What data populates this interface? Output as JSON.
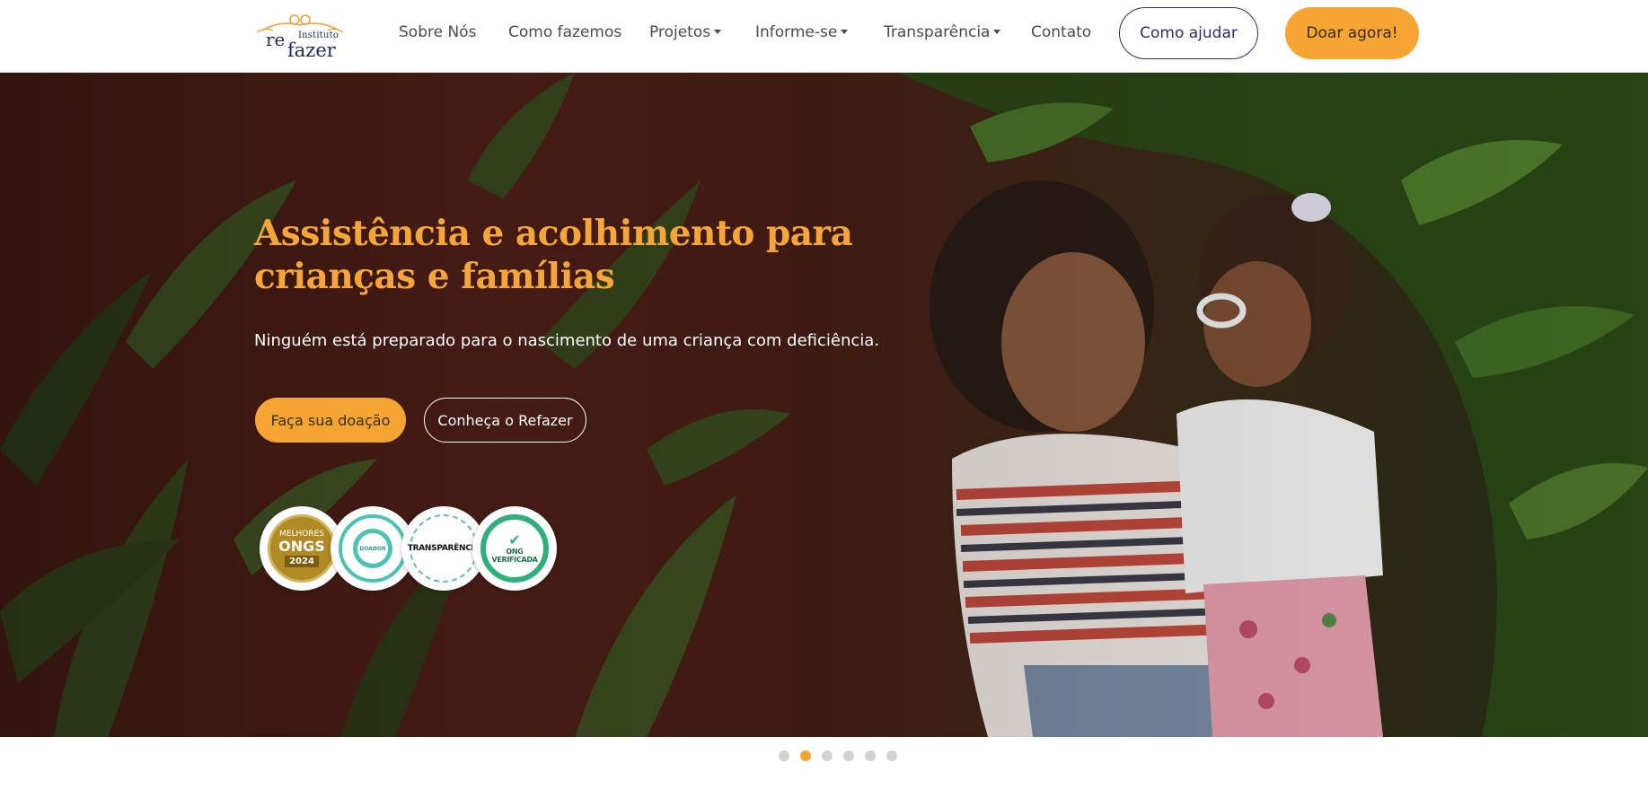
{
  "brand": {
    "logo_word_top": "Instituto",
    "logo_word_re": "re",
    "logo_word_fazer": "fazer",
    "accent_color": "#f5a632",
    "navy_color": "#2a2e5e"
  },
  "nav": {
    "links": [
      {
        "label": "Sobre Nós",
        "has_dropdown": false
      },
      {
        "label": "Como fazemos",
        "has_dropdown": false
      },
      {
        "label": "Projetos",
        "has_dropdown": true
      },
      {
        "label": "Informe-se",
        "has_dropdown": true
      },
      {
        "label": "Transparência",
        "has_dropdown": true
      },
      {
        "label": "Contato",
        "has_dropdown": false
      }
    ],
    "help_button": "Como ajudar",
    "donate_button": "Doar agora!"
  },
  "hero": {
    "title": "Assistência e acolhimento para crianças e famílias",
    "subtitle": "Ninguém está preparado para o nascimento de uma criança com deficiência.",
    "primary_button": "Faça sua doação",
    "secondary_button": "Conheça o Refazer",
    "seals": [
      {
        "name": "melhores-ongs",
        "line1": "MELHORES",
        "line2": "ONGS",
        "line3": "2024"
      },
      {
        "name": "doador-certificado",
        "text": "DOADOR"
      },
      {
        "name": "transparencia",
        "text": "TRANSPARÊNCIA"
      },
      {
        "name": "ong-verificada",
        "text": "ONG VERIFICADA"
      }
    ]
  },
  "carousel": {
    "slide_count": 6,
    "active_index": 1
  }
}
